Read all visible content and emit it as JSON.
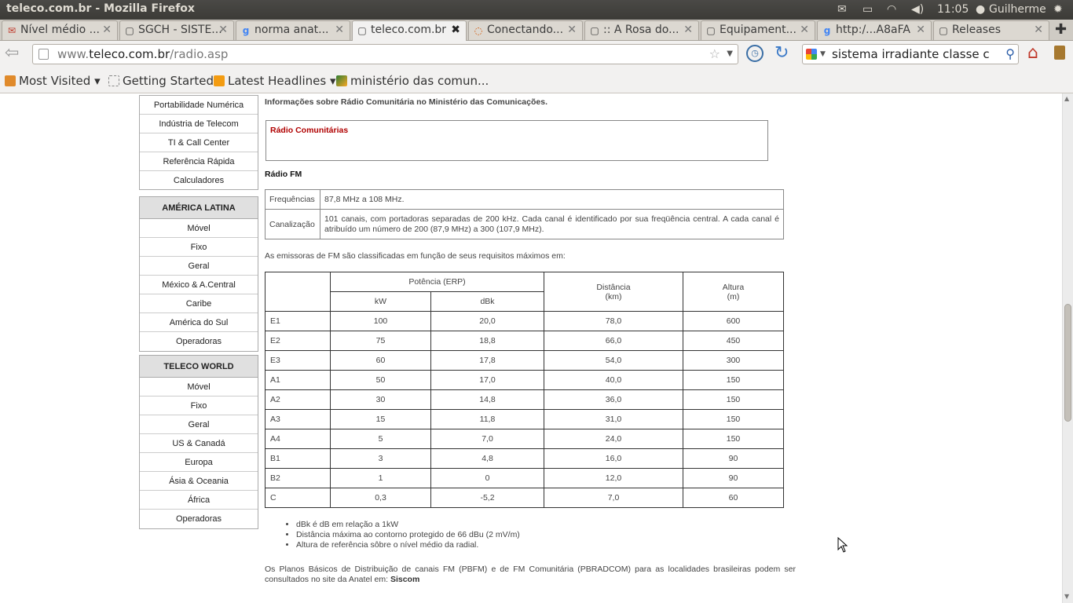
{
  "window": {
    "title": "teleco.com.br - Mozilla Firefox"
  },
  "system": {
    "time": "11:05",
    "user": "Guilherme"
  },
  "tabs": [
    {
      "label": "Nível médio ...",
      "active": false
    },
    {
      "label": "SGCH - SISTE...",
      "active": false
    },
    {
      "label": "norma anat...",
      "active": false
    },
    {
      "label": "teleco.com.br",
      "active": true
    },
    {
      "label": "Conectando...",
      "active": false
    },
    {
      "label": ":: A Rosa do...",
      "active": false
    },
    {
      "label": "Equipament...",
      "active": false
    },
    {
      "label": "http:/...A8aFA",
      "active": false
    },
    {
      "label": "Releases",
      "active": false
    }
  ],
  "nav": {
    "url_host": "www.teleco.com.br",
    "url_domain": "teleco.com.br",
    "url_path": "/radio.asp",
    "search_text": "sistema irradiante classe c"
  },
  "bookmarks": [
    {
      "label": "Most Visited"
    },
    {
      "label": "Getting Started"
    },
    {
      "label": "Latest Headlines"
    },
    {
      "label": "ministério das comun..."
    }
  ],
  "sidebar": {
    "top_items": [
      "Portabilidade Numérica",
      "Indústria de Telecom",
      "TI & Call Center",
      "Referência Rápida",
      "Calculadores"
    ],
    "latam": {
      "header": "AMÉRICA LATINA",
      "items": [
        "Móvel",
        "Fixo",
        "Geral",
        "México & A.Central",
        "Caribe",
        "América do Sul",
        "Operadoras"
      ]
    },
    "world": {
      "header": "TELECO WORLD",
      "items": [
        "Móvel",
        "Fixo",
        "Geral",
        "US & Canadá",
        "Europa",
        "Ásia & Oceania",
        "África",
        "Operadoras"
      ]
    }
  },
  "main": {
    "intro": "Informações sobre Rádio Comunitária no Ministério das Comunicações.",
    "radiocom_link": "Rádio Comunitárias",
    "fm_title": "Rádio FM",
    "freq_rows": [
      {
        "label": "Frequências",
        "value": "87,8 MHz a 108 MHz."
      },
      {
        "label": "Canalização",
        "value": "101 canais, com portadoras separadas de 200 kHz. Cada canal é identificado por sua freqüência central. A cada canal é atribuído um número de 200 (87,9 MHz) a 300 (107,9 MHz)."
      }
    ],
    "class_intro": "As emissoras de FM são classificadas em função de seus requisitos máximos em:",
    "class_headers": {
      "power": "Potência (ERP)",
      "kw": "kW",
      "dbk": "dBk",
      "distance": "Distância",
      "distance_unit": "(km)",
      "height": "Altura",
      "height_unit": "(m)"
    },
    "classes": [
      {
        "cls": "E1",
        "kw": "100",
        "dbk": "20,0",
        "dist": "78,0",
        "height": "600"
      },
      {
        "cls": "E2",
        "kw": "75",
        "dbk": "18,8",
        "dist": "66,0",
        "height": "450"
      },
      {
        "cls": "E3",
        "kw": "60",
        "dbk": "17,8",
        "dist": "54,0",
        "height": "300"
      },
      {
        "cls": "A1",
        "kw": "50",
        "dbk": "17,0",
        "dist": "40,0",
        "height": "150"
      },
      {
        "cls": "A2",
        "kw": "30",
        "dbk": "14,8",
        "dist": "36,0",
        "height": "150"
      },
      {
        "cls": "A3",
        "kw": "15",
        "dbk": "11,8",
        "dist": "31,0",
        "height": "150"
      },
      {
        "cls": "A4",
        "kw": "5",
        "dbk": "7,0",
        "dist": "24,0",
        "height": "150"
      },
      {
        "cls": "B1",
        "kw": "3",
        "dbk": "4,8",
        "dist": "16,0",
        "height": "90"
      },
      {
        "cls": "B2",
        "kw": "1",
        "dbk": "0",
        "dist": "12,0",
        "height": "90"
      },
      {
        "cls": "C",
        "kw": "0,3",
        "dbk": "-5,2",
        "dist": "7,0",
        "height": "60"
      }
    ],
    "notes": [
      "dBk é dB em relação a 1kW",
      "Distância máxima ao contorno protegido de 66 dBu (2 mV/m)",
      "Altura de referência sôbre o nível médio da radial."
    ],
    "footer_text": "Os Planos Básicos de Distribuição de canais FM (PBFM) e de FM Comunitária (PBRADCOM) para as localidades brasileiras podem ser consultados no site da Anatel em: ",
    "footer_link": "Siscom"
  }
}
